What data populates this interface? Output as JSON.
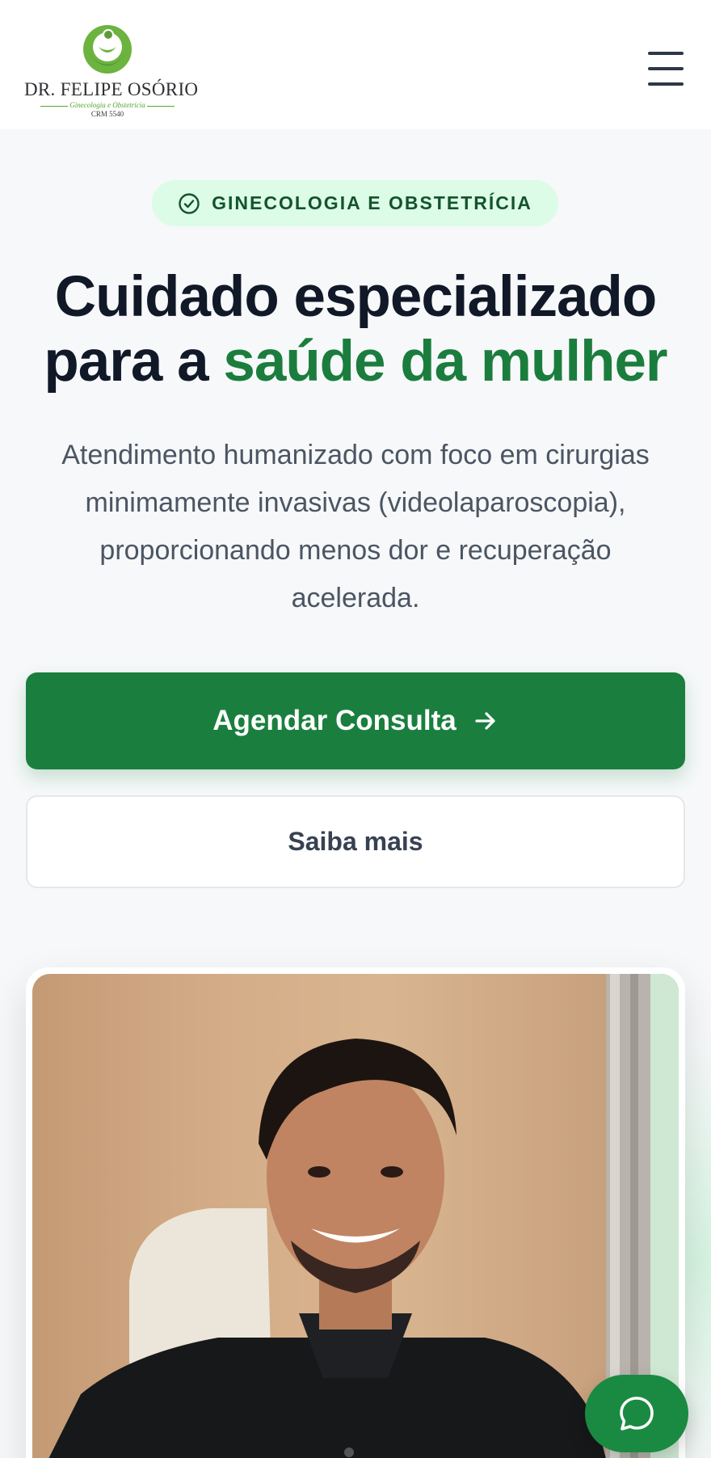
{
  "header": {
    "logo": {
      "name": "DR. FELIPE OSÓRIO",
      "specialty": "Ginecologia e Obstetrícia",
      "crm": "CRM 5540"
    },
    "menu_icon": "hamburger-menu-icon"
  },
  "hero": {
    "badge": {
      "icon": "check-circle-icon",
      "label": "GINECOLOGIA E OBSTETRÍCIA"
    },
    "headline_part1": "Cuidado especializado",
    "headline_part2": "para a ",
    "headline_highlight": "saúde da mulher",
    "subtitle": "Atendimento humanizado com foco em cirurgias minimamente invasivas (videolaparoscopia), proporcionando menos dor e recuperação acelerada.",
    "primary_button": {
      "label": "Agendar Consulta",
      "icon": "arrow-right-icon"
    },
    "secondary_button": {
      "label": "Saiba mais"
    }
  },
  "chat_button": {
    "icon": "chat-bubble-icon"
  },
  "colors": {
    "brand_green": "#1a7f3e",
    "badge_bg": "#dcfce7",
    "badge_text": "#14532d",
    "headline": "#111827",
    "body_text": "#4b5563"
  }
}
